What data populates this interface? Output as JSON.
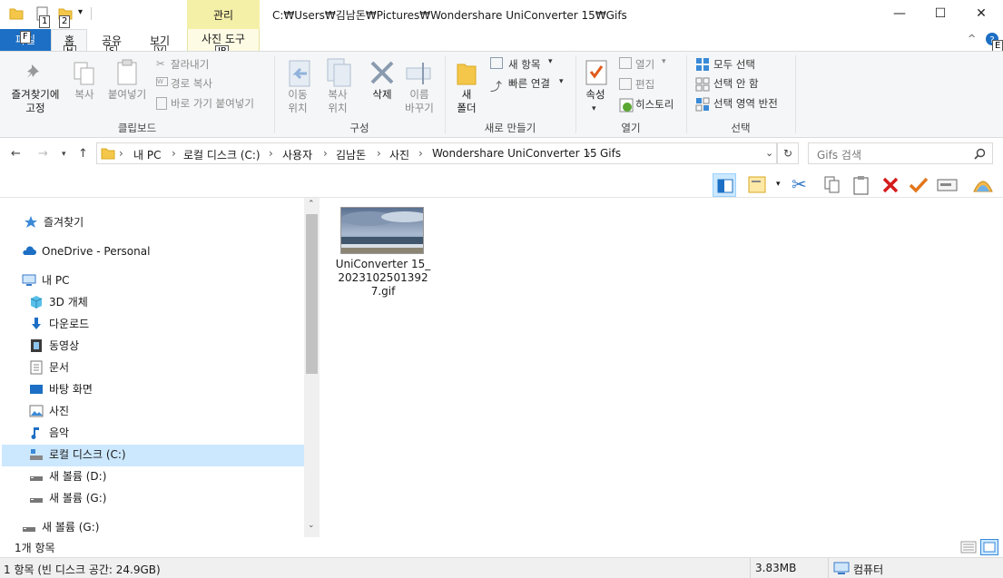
{
  "title_bar": {
    "manage_tab": "관리",
    "path": "C:₩Users₩김남돈₩Pictures₩Wondershare UniConverter 15₩Gifs",
    "minimize": "—",
    "maximize": "☐",
    "close": "✕",
    "qa_keytips": [
      "1",
      "2"
    ]
  },
  "ribbon_tabs": {
    "file": "파일",
    "home": "홈",
    "share": "공유",
    "view": "보기",
    "picture_tools": "사진 도구",
    "keytips": {
      "file": "F",
      "home": "H",
      "share": "S",
      "view": "V",
      "picture_tools": "JP",
      "help": "E"
    }
  },
  "ribbon": {
    "clipboard": {
      "group": "클립보드",
      "pin": "즐겨찾기에\n고정",
      "copy": "복사",
      "paste": "붙여넣기",
      "cut": "잘라내기",
      "copy_path": "경로 복사",
      "paste_shortcut": "바로 가기 붙여넣기"
    },
    "organize": {
      "group": "구성",
      "move_to": "이동\n위치",
      "copy_to": "복사\n위치",
      "delete": "삭제",
      "rename": "이름\n바꾸기"
    },
    "new": {
      "group": "새로 만들기",
      "new_folder": "새\n폴더",
      "new_item": "새 항목",
      "easy_access": "빠른 연결"
    },
    "open": {
      "group": "열기",
      "properties": "속성",
      "open": "열기",
      "edit": "편집",
      "history": "히스토리"
    },
    "select": {
      "group": "선택",
      "select_all": "모두 선택",
      "select_none": "선택 안 함",
      "invert": "선택 영역 반전"
    }
  },
  "address": {
    "crumbs": [
      "내 PC",
      "로컬 디스크 (C:)",
      "사용자",
      "김남돈",
      "사진",
      "Wondershare UniConverter 15",
      "Gifs"
    ],
    "search_placeholder": "Gifs 검색"
  },
  "nav_pane": {
    "items": [
      {
        "label": "즐겨찾기",
        "icon": "star-icon"
      },
      {
        "label": "OneDrive - Personal",
        "icon": "cloud-icon"
      },
      {
        "label": "내 PC",
        "icon": "pc-icon"
      },
      {
        "label": "3D 개체",
        "icon": "cube-icon"
      },
      {
        "label": "다운로드",
        "icon": "download-icon"
      },
      {
        "label": "동영상",
        "icon": "video-icon"
      },
      {
        "label": "문서",
        "icon": "document-icon"
      },
      {
        "label": "바탕 화면",
        "icon": "desktop-icon"
      },
      {
        "label": "사진",
        "icon": "pictures-icon"
      },
      {
        "label": "음악",
        "icon": "music-icon"
      },
      {
        "label": "로컬 디스크 (C:)",
        "icon": "drive-icon"
      },
      {
        "label": "새 볼륨 (D:)",
        "icon": "drive-icon"
      },
      {
        "label": "새 볼륨 (G:)",
        "icon": "drive-icon"
      },
      {
        "label": "새 볼륨 (G:)",
        "icon": "drive-icon"
      }
    ],
    "selected_index": 10
  },
  "files": [
    {
      "name": "UniConverter 15_20231025013927.gif"
    }
  ],
  "status": {
    "item_count": "1개 항목",
    "detail": "1 항목 (빈 디스크 공간: 24.9GB)",
    "size": "3.83MB",
    "location": "컴퓨터"
  },
  "colors": {
    "accent": "#1c6fc4",
    "manage_tab": "#f5f0a8",
    "selection": "#cce8ff"
  }
}
